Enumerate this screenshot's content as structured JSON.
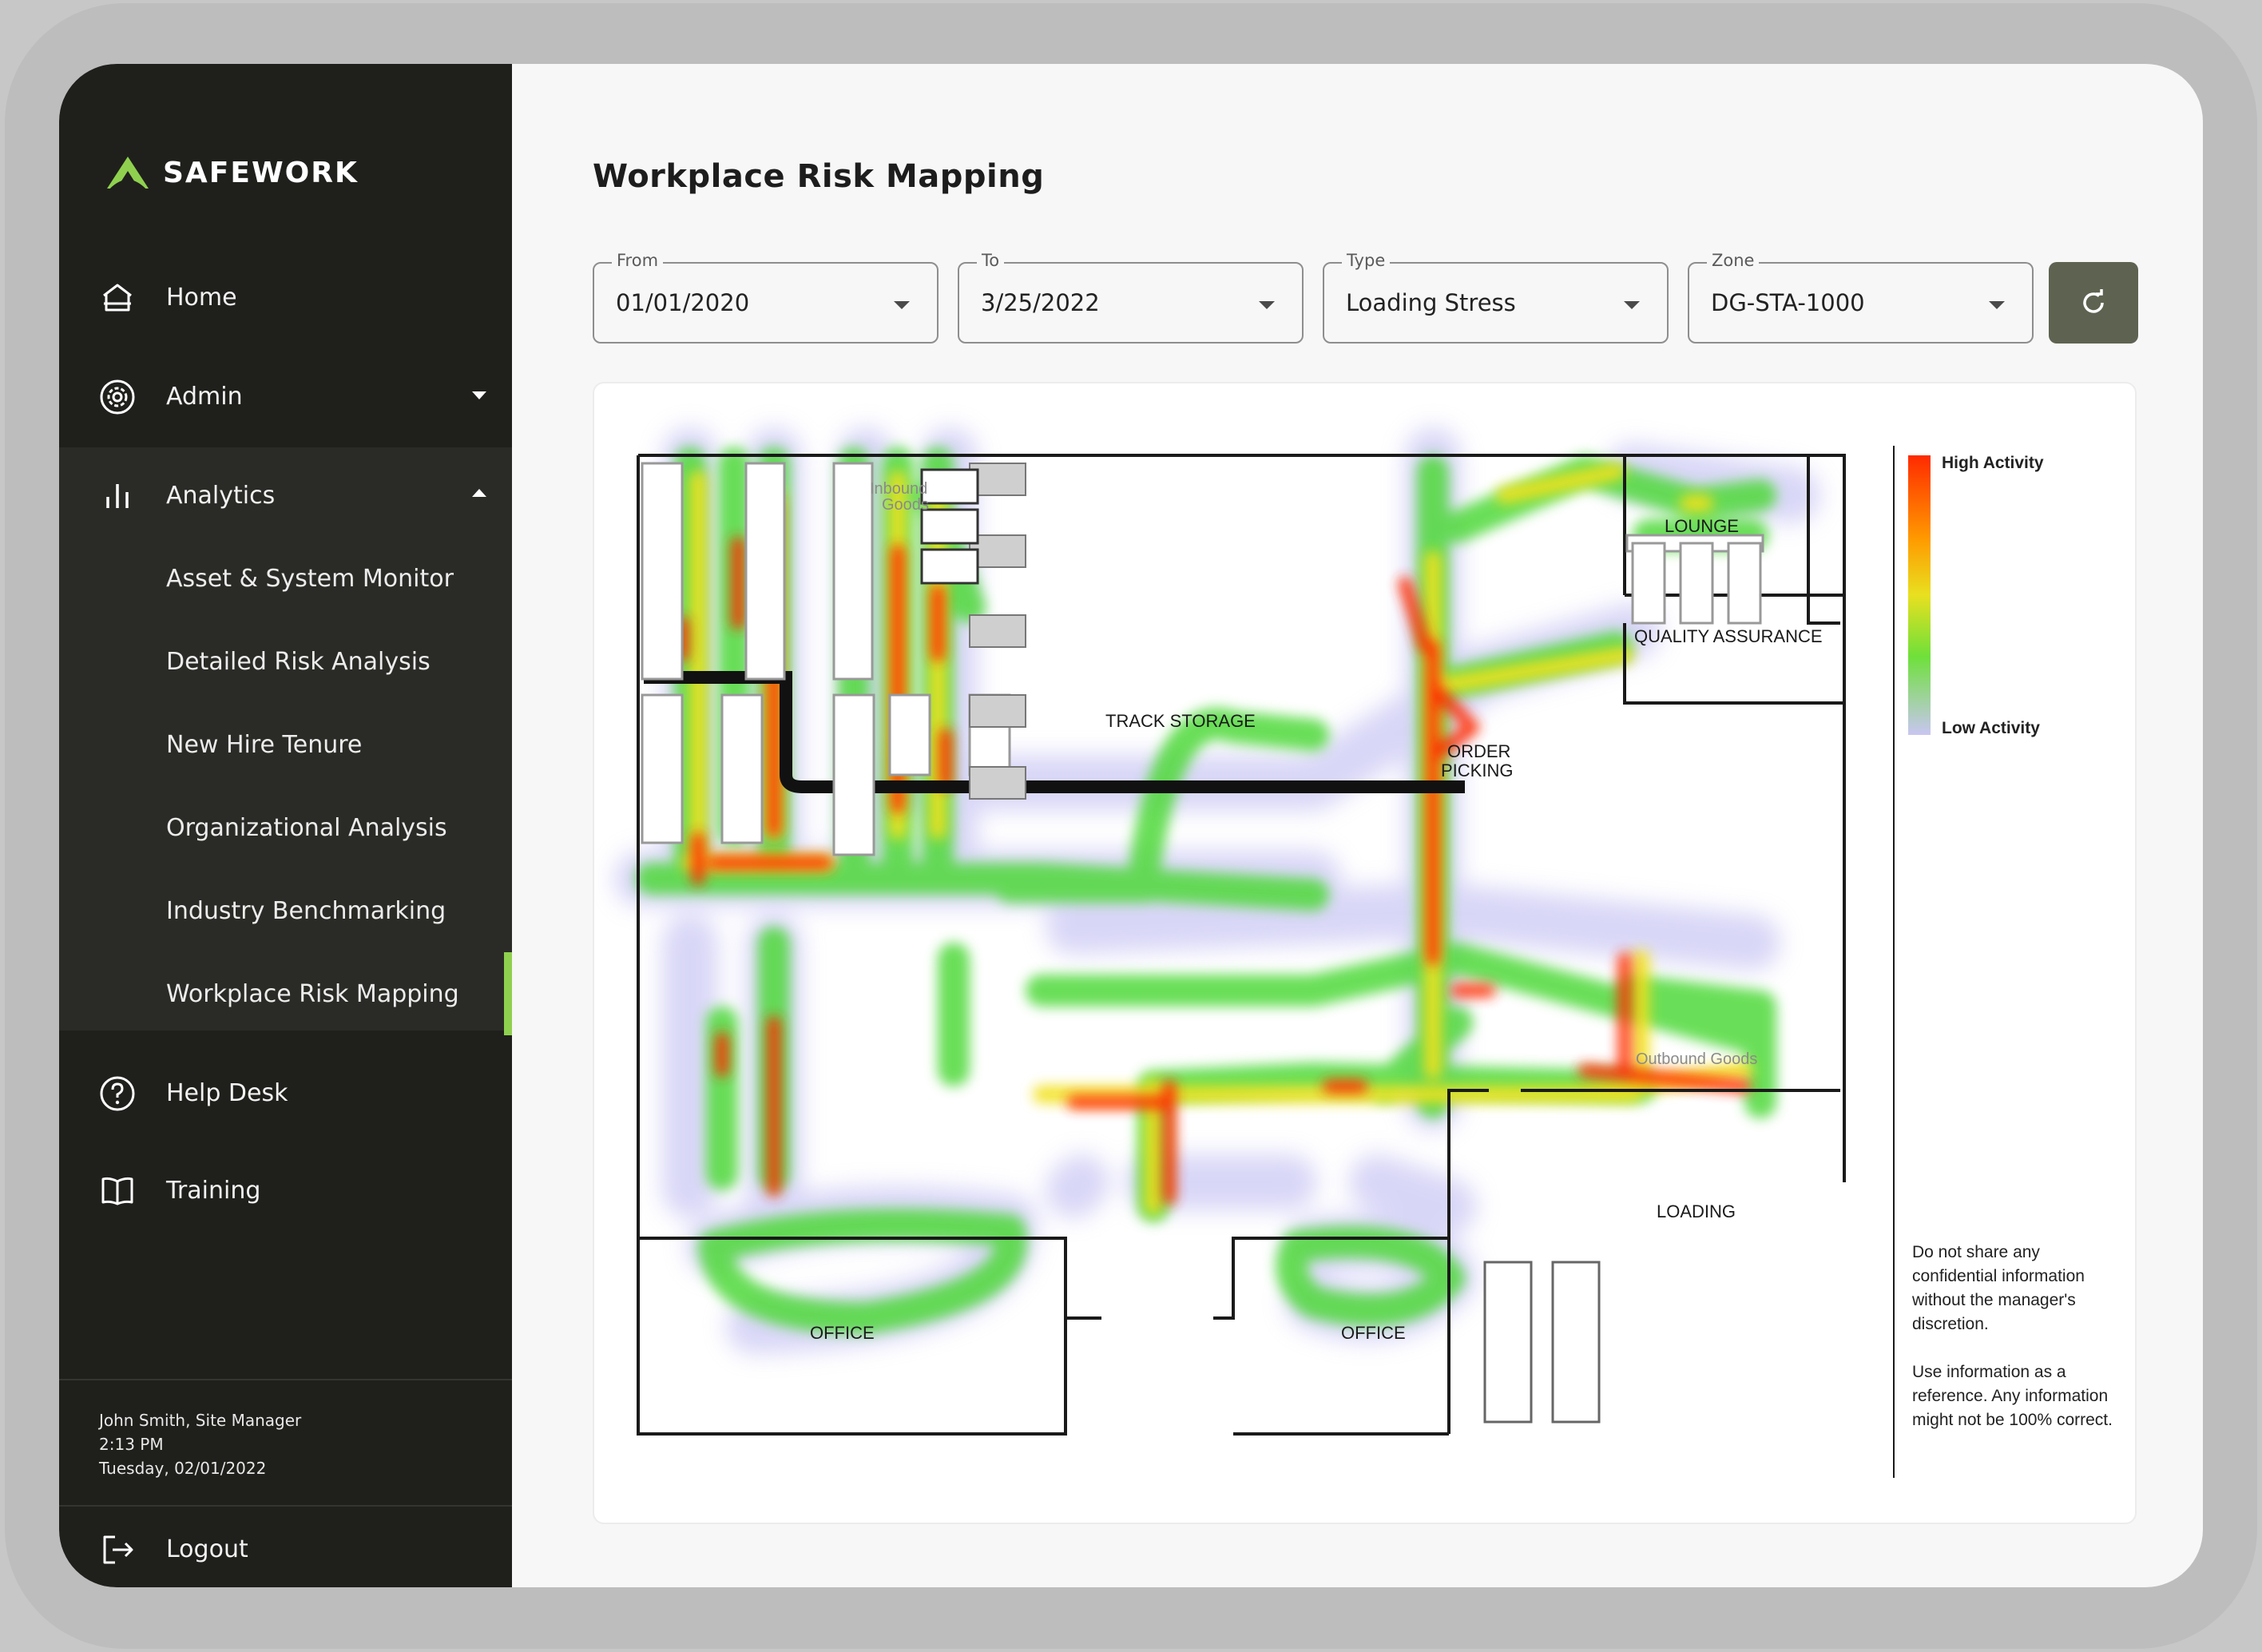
{
  "app": {
    "brand": "SAFEWORK",
    "accent_color": "#8fd14f"
  },
  "sidebar": {
    "items": [
      {
        "label": "Home",
        "icon": "home-icon"
      },
      {
        "label": "Admin",
        "icon": "gear-icon"
      },
      {
        "label": "Analytics",
        "icon": "bar-chart-icon"
      }
    ],
    "analytics_subitems": [
      {
        "label": "Asset & System Monitor"
      },
      {
        "label": "Detailed Risk Analysis"
      },
      {
        "label": "New Hire Tenure"
      },
      {
        "label": "Organizational Analysis"
      },
      {
        "label": "Industry Benchmarking"
      },
      {
        "label": "Workplace Risk Mapping",
        "active": true
      }
    ],
    "bottom_items": [
      {
        "label": "Help Desk",
        "icon": "help-circle-icon"
      },
      {
        "label": "Training",
        "icon": "book-icon"
      }
    ],
    "user": {
      "name_role": "John Smith, Site Manager",
      "time": "2:13 PM",
      "date": "Tuesday, 02/01/2022"
    },
    "logout": {
      "label": "Logout",
      "icon": "logout-icon"
    }
  },
  "main": {
    "title": "Workplace Risk Mapping",
    "filters": {
      "from": {
        "label": "From",
        "value": "01/01/2020"
      },
      "to": {
        "label": "To",
        "value": "3/25/2022"
      },
      "type": {
        "label": "Type",
        "value": "Loading Stress"
      },
      "zone": {
        "label": "Zone",
        "value": "DG-STA-1000"
      }
    },
    "refresh": {
      "icon": "refresh-icon"
    }
  },
  "map": {
    "labels": {
      "inbound_1": "Inbound",
      "inbound_2": "Goods",
      "lounge": "LOUNGE",
      "quality": "QUALITY ASSURANCE",
      "track": "TRACK STORAGE",
      "order_1": "ORDER",
      "order_2": "PICKING",
      "outbound": "Outbound Goods",
      "loading": "LOADING",
      "office_1": "OFFICE",
      "office_2": "OFFICE"
    },
    "legend": {
      "high": "High Activity",
      "low": "Low Activity",
      "colors": [
        "#ff2a00",
        "#ffd400",
        "#6ee03a",
        "#c9c6f2"
      ]
    },
    "note_1": "Do not share any confidential information without the manager's discretion.",
    "note_2": "Use information as a reference. Any information might not be 100% correct."
  }
}
